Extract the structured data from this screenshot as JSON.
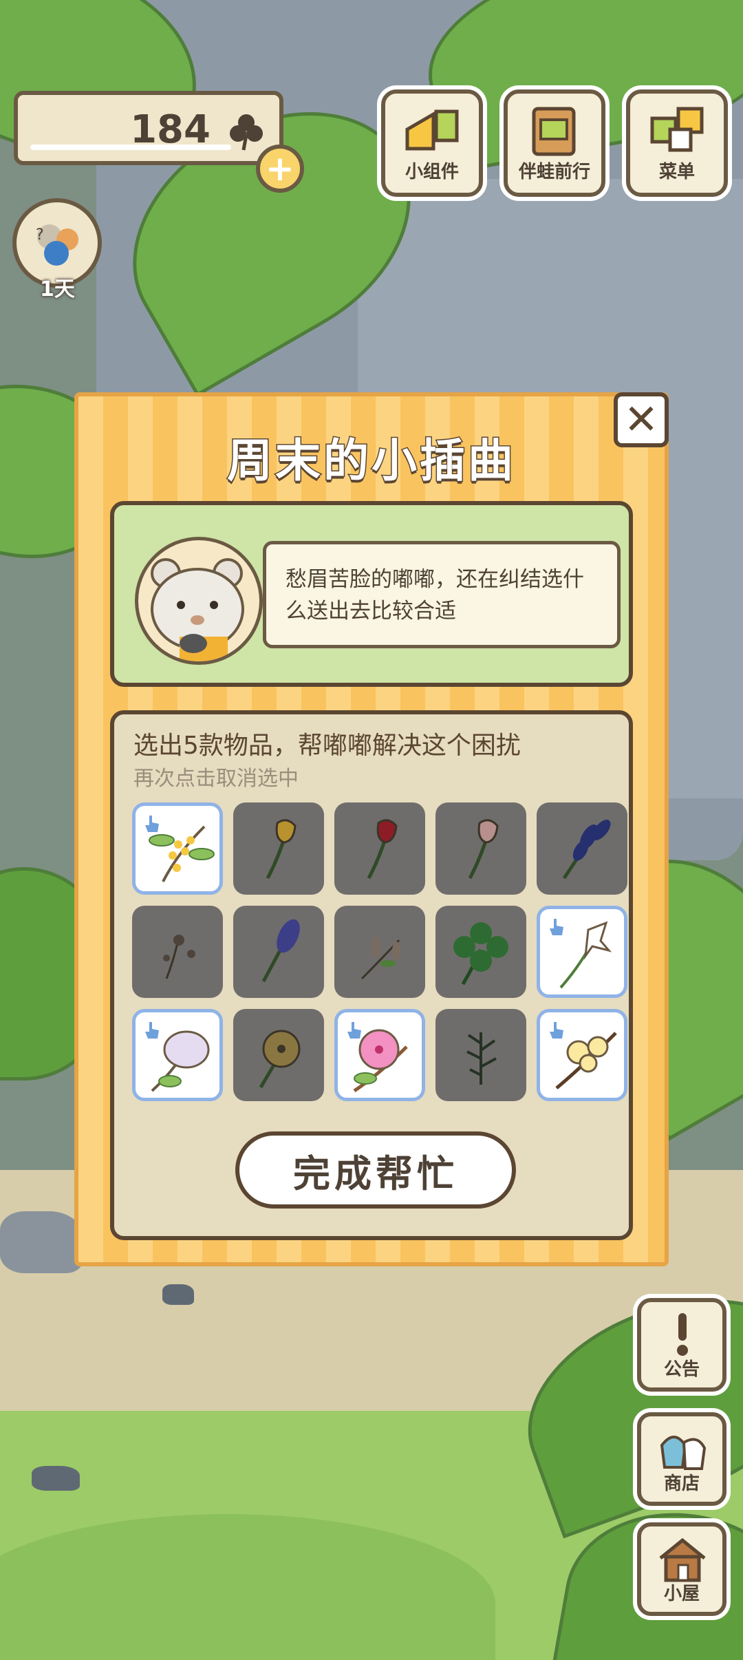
{
  "hud": {
    "clover_count": "184",
    "days_label": "1天",
    "buttons": [
      {
        "label": "小组件",
        "icon": "widget-icon"
      },
      {
        "label": "伴蛙前行",
        "icon": "album-icon"
      },
      {
        "label": "菜单",
        "icon": "menu-cards-icon"
      }
    ],
    "side_buttons": [
      {
        "label": "公告",
        "icon": "exclamation-icon"
      },
      {
        "label": "商店",
        "icon": "shop-bags-icon"
      },
      {
        "label": "小屋",
        "icon": "house-icon"
      }
    ]
  },
  "modal": {
    "title": "周末的小插曲",
    "npc_message": "愁眉苦脸的嘟嘟，还在纠结选什么送出去比较合适",
    "instruction": "选出5款物品，帮嘟嘟解决这个困扰",
    "hint": "再次点击取消选中",
    "confirm_label": "完成帮忙",
    "items": [
      {
        "icon": "osmanthus-icon",
        "selected": true
      },
      {
        "icon": "yellow-tulip-icon",
        "selected": false
      },
      {
        "icon": "red-tulip-icon",
        "selected": false
      },
      {
        "icon": "pink-tulip-icon",
        "selected": false
      },
      {
        "icon": "iris-icon",
        "selected": false
      },
      {
        "icon": "dandelion-icon",
        "selected": false
      },
      {
        "icon": "hyacinth-icon",
        "selected": false
      },
      {
        "icon": "catkin-icon",
        "selected": false
      },
      {
        "icon": "four-leaf-clover-icon",
        "selected": false
      },
      {
        "icon": "lily-icon",
        "selected": true
      },
      {
        "icon": "lilac-icon",
        "selected": true
      },
      {
        "icon": "buttercup-icon",
        "selected": false
      },
      {
        "icon": "hibiscus-icon",
        "selected": true
      },
      {
        "icon": "herb-sprig-icon",
        "selected": false
      },
      {
        "icon": "wintersweet-icon",
        "selected": true
      }
    ]
  }
}
